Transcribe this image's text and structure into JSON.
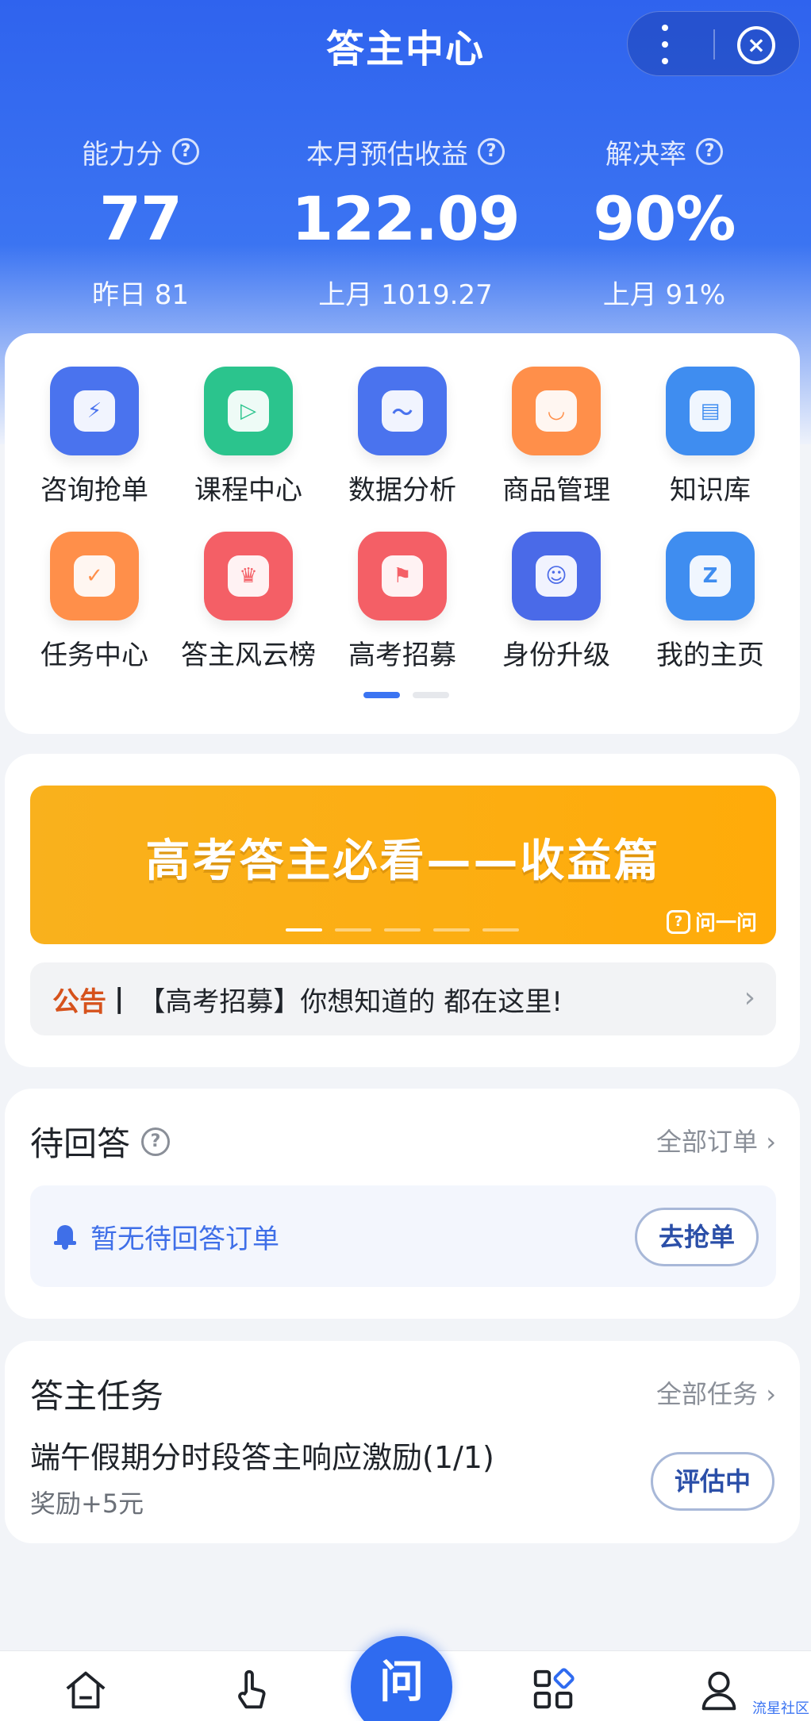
{
  "header": {
    "title": "答主中心"
  },
  "stats": [
    {
      "label": "能力分",
      "value": "77",
      "sub": "昨日 81"
    },
    {
      "label": "本月预估收益",
      "value": "122.09",
      "sub": "上月 1019.27"
    },
    {
      "label": "解决率",
      "value": "90%",
      "sub": "上月 91%"
    }
  ],
  "help_glyph": "?",
  "grid": [
    {
      "label": "咨询抢单",
      "icon": "lightning-icon",
      "color": "#4a73ee",
      "glyph": "⚡"
    },
    {
      "label": "课程中心",
      "icon": "play-icon",
      "color": "#2bc48d",
      "glyph": "▷"
    },
    {
      "label": "数据分析",
      "icon": "chart-icon",
      "color": "#4a73ee",
      "glyph": "〜"
    },
    {
      "label": "商品管理",
      "icon": "bag-icon",
      "color": "#ff8f4a",
      "glyph": "◡"
    },
    {
      "label": "知识库",
      "icon": "book-icon",
      "color": "#3f8df0",
      "glyph": "▤"
    },
    {
      "label": "任务中心",
      "icon": "task-icon",
      "color": "#ff8f4a",
      "glyph": "✓"
    },
    {
      "label": "答主风云榜",
      "icon": "trophy-icon",
      "color": "#f45f66",
      "glyph": "♛"
    },
    {
      "label": "高考招募",
      "icon": "flag-icon",
      "color": "#f45f66",
      "glyph": "⚑"
    },
    {
      "label": "身份升级",
      "icon": "user-upgrade-icon",
      "color": "#4a6ae8",
      "glyph": "☺"
    },
    {
      "label": "我的主页",
      "icon": "home-star-icon",
      "color": "#3f8df0",
      "glyph": "Z"
    }
  ],
  "banner": {
    "title": "高考答主必看——收益篇",
    "brand": "问一问",
    "brand_glyph": "?"
  },
  "notice": {
    "tag": "公告",
    "separator": "|",
    "text": "【高考招募】你想知道的 都在这里!",
    "chevron": "›"
  },
  "pending": {
    "title": "待回答",
    "more": "全部订单 ›",
    "empty_text": "暂无待回答订单",
    "action": "去抢单"
  },
  "tasks": {
    "title": "答主任务",
    "more": "全部任务 ›",
    "item": "端午假期分时段答主响应激励(1/1)",
    "reward": "奖励+5元",
    "status": "评估中"
  },
  "tabbar": {
    "center": "问",
    "tabs": [
      {
        "label": "",
        "icon": "home-icon"
      },
      {
        "label": "",
        "icon": "tap-icon"
      },
      {
        "label": "",
        "icon": "grid-icon"
      },
      {
        "label": "",
        "icon": "profile-icon"
      }
    ]
  },
  "watermark": "流星社区",
  "capsule": {
    "close_glyph": "×"
  }
}
